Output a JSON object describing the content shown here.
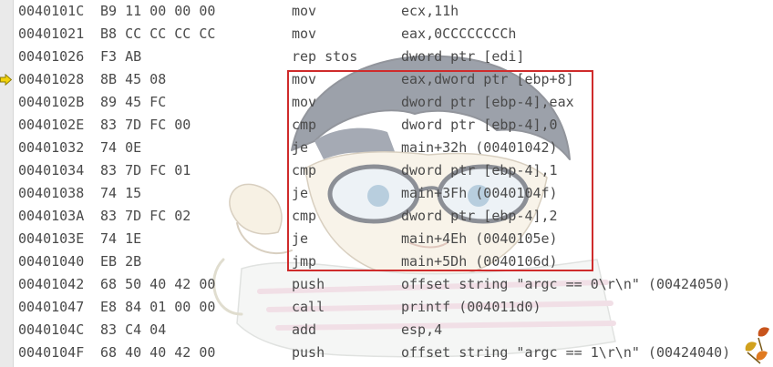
{
  "disassembly": {
    "current_row_index": 3,
    "highlight": {
      "first_row": 3,
      "last_row": 11,
      "color": "#cf2b2b"
    },
    "current_marker_color": "#f2d20a",
    "rows": [
      {
        "address": "0040101C",
        "bytes": "B9 11 00 00 00",
        "mnemonic": "mov",
        "operands": "ecx,11h"
      },
      {
        "address": "00401021",
        "bytes": "B8 CC CC CC CC",
        "mnemonic": "mov",
        "operands": "eax,0CCCCCCCCh"
      },
      {
        "address": "00401026",
        "bytes": "F3 AB",
        "mnemonic": "rep stos",
        "operands": "dword ptr [edi]"
      },
      {
        "address": "00401028",
        "bytes": "8B 45 08",
        "mnemonic": "mov",
        "operands": "eax,dword ptr [ebp+8]"
      },
      {
        "address": "0040102B",
        "bytes": "89 45 FC",
        "mnemonic": "mov",
        "operands": "dword ptr [ebp-4],eax"
      },
      {
        "address": "0040102E",
        "bytes": "83 7D FC 00",
        "mnemonic": "cmp",
        "operands": "dword ptr [ebp-4],0"
      },
      {
        "address": "00401032",
        "bytes": "74 0E",
        "mnemonic": "je",
        "operands": "main+32h (00401042)"
      },
      {
        "address": "00401034",
        "bytes": "83 7D FC 01",
        "mnemonic": "cmp",
        "operands": "dword ptr [ebp-4],1"
      },
      {
        "address": "00401038",
        "bytes": "74 15",
        "mnemonic": "je",
        "operands": "main+3Fh (0040104f)"
      },
      {
        "address": "0040103A",
        "bytes": "83 7D FC 02",
        "mnemonic": "cmp",
        "operands": "dword ptr [ebp-4],2"
      },
      {
        "address": "0040103E",
        "bytes": "74 1E",
        "mnemonic": "je",
        "operands": "main+4Eh (0040105e)"
      },
      {
        "address": "00401040",
        "bytes": "EB 2B",
        "mnemonic": "jmp",
        "operands": "main+5Dh (0040106d)"
      },
      {
        "address": "00401042",
        "bytes": "68 50 40 42 00",
        "mnemonic": "push",
        "operands": "offset string \"argc == 0\\r\\n\" (00424050)"
      },
      {
        "address": "00401047",
        "bytes": "E8 84 01 00 00",
        "mnemonic": "call",
        "operands": "printf (004011d0)"
      },
      {
        "address": "0040104C",
        "bytes": "83 C4 04",
        "mnemonic": "add",
        "operands": "esp,4"
      },
      {
        "address": "0040104F",
        "bytes": "68 40 40 42 00",
        "mnemonic": "push",
        "operands": "offset string \"argc == 1\\r\\n\" (00424040)"
      }
    ]
  }
}
